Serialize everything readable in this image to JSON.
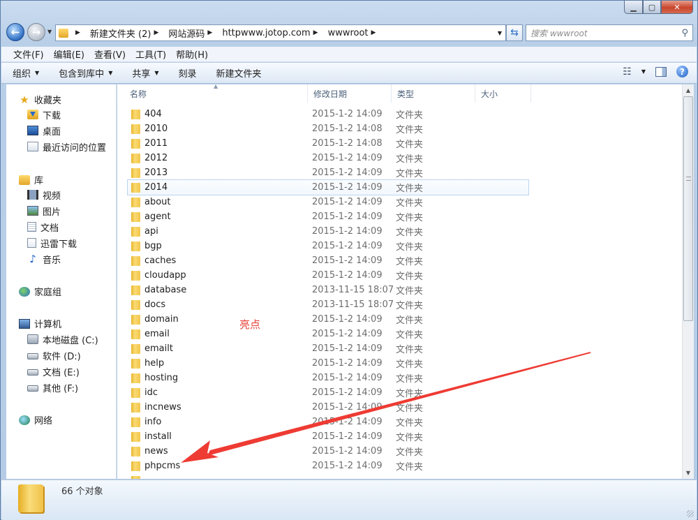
{
  "address": {
    "crumbs": [
      "新建文件夹 (2)",
      "网站源码",
      "httpwww.jotop.com",
      "wwwroot"
    ],
    "search_placeholder": "搜索 wwwroot"
  },
  "menu": [
    "文件(F)",
    "编辑(E)",
    "查看(V)",
    "工具(T)",
    "帮助(H)"
  ],
  "toolbar": {
    "organize": "组织",
    "include_library": "包含到库中",
    "share": "共享",
    "burn": "刻录",
    "new_folder": "新建文件夹"
  },
  "nav": {
    "favorites": "收藏夹",
    "downloads": "下载",
    "desktop": "桌面",
    "recent": "最近访问的位置",
    "libraries": "库",
    "videos": "视频",
    "pictures": "图片",
    "documents": "文档",
    "xunlei": "迅雷下载",
    "music": "音乐",
    "homegroup": "家庭组",
    "computer": "计算机",
    "drive_c": "本地磁盘 (C:)",
    "drive_d": "软件 (D:)",
    "drive_e": "文档 (E:)",
    "drive_f": "其他 (F:)",
    "network": "网络"
  },
  "columns": {
    "name": "名称",
    "date": "修改日期",
    "type": "类型",
    "size": "大小"
  },
  "files": [
    {
      "name": "404",
      "date": "2015-1-2 14:09",
      "type": "文件夹"
    },
    {
      "name": "2010",
      "date": "2015-1-2 14:08",
      "type": "文件夹"
    },
    {
      "name": "2011",
      "date": "2015-1-2 14:08",
      "type": "文件夹"
    },
    {
      "name": "2012",
      "date": "2015-1-2 14:09",
      "type": "文件夹"
    },
    {
      "name": "2013",
      "date": "2015-1-2 14:09",
      "type": "文件夹"
    },
    {
      "name": "2014",
      "date": "2015-1-2 14:09",
      "type": "文件夹"
    },
    {
      "name": "about",
      "date": "2015-1-2 14:09",
      "type": "文件夹"
    },
    {
      "name": "agent",
      "date": "2015-1-2 14:09",
      "type": "文件夹"
    },
    {
      "name": "api",
      "date": "2015-1-2 14:09",
      "type": "文件夹"
    },
    {
      "name": "bgp",
      "date": "2015-1-2 14:09",
      "type": "文件夹"
    },
    {
      "name": "caches",
      "date": "2015-1-2 14:09",
      "type": "文件夹"
    },
    {
      "name": "cloudapp",
      "date": "2015-1-2 14:09",
      "type": "文件夹"
    },
    {
      "name": "database",
      "date": "2013-11-15 18:07",
      "type": "文件夹"
    },
    {
      "name": "docs",
      "date": "2013-11-15 18:07",
      "type": "文件夹"
    },
    {
      "name": "domain",
      "date": "2015-1-2 14:09",
      "type": "文件夹"
    },
    {
      "name": "email",
      "date": "2015-1-2 14:09",
      "type": "文件夹"
    },
    {
      "name": "emailt",
      "date": "2015-1-2 14:09",
      "type": "文件夹"
    },
    {
      "name": "help",
      "date": "2015-1-2 14:09",
      "type": "文件夹"
    },
    {
      "name": "hosting",
      "date": "2015-1-2 14:09",
      "type": "文件夹"
    },
    {
      "name": "idc",
      "date": "2015-1-2 14:09",
      "type": "文件夹"
    },
    {
      "name": "incnews",
      "date": "2015-1-2 14:09",
      "type": "文件夹"
    },
    {
      "name": "info",
      "date": "2015-1-2 14:09",
      "type": "文件夹"
    },
    {
      "name": "install",
      "date": "2015-1-2 14:09",
      "type": "文件夹"
    },
    {
      "name": "news",
      "date": "2015-1-2 14:09",
      "type": "文件夹"
    },
    {
      "name": "phpcms",
      "date": "2015-1-2 14:09",
      "type": "文件夹"
    },
    {
      "name": "",
      "date": "",
      "type": ""
    }
  ],
  "selected_index": 5,
  "status": {
    "count": "66 个对象"
  },
  "annotation": {
    "text": "亮点",
    "color": "#e8443a"
  }
}
